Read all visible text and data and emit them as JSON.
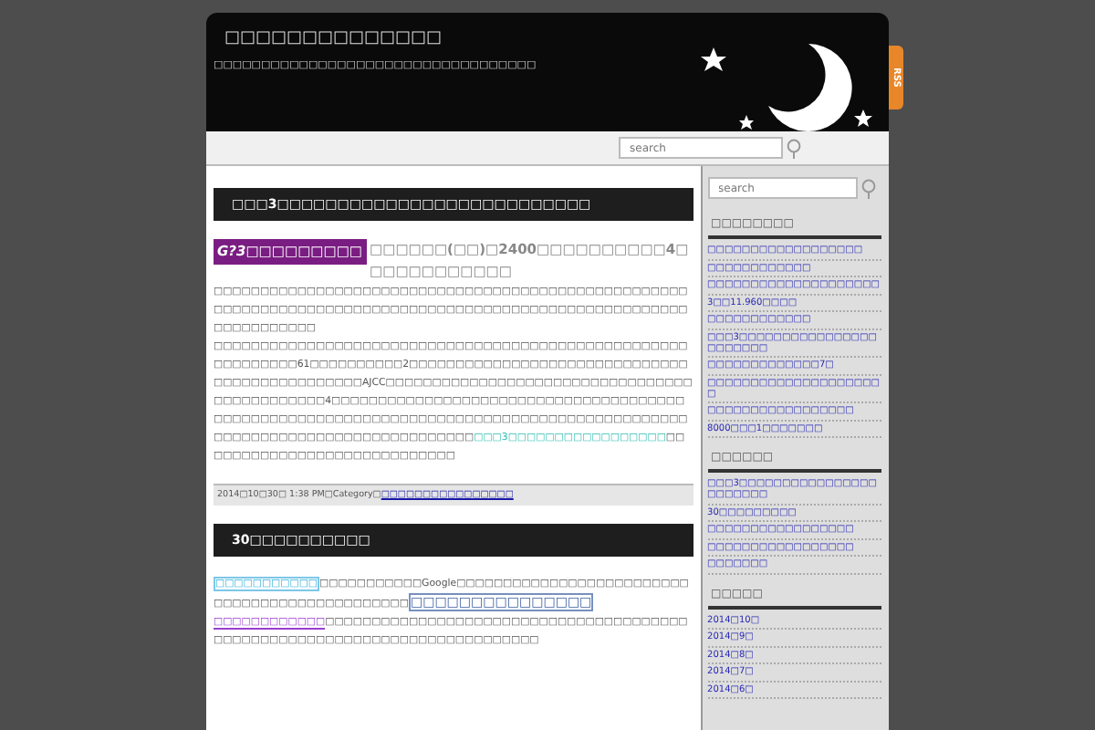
{
  "header": {
    "title": "□□□□□□□□□□□□□□",
    "subtitle": "□□□□□□□□□□□□□□□□□□□□□□□□□□□□□□□□□□",
    "rss": "RSS"
  },
  "nav": {
    "search": {
      "placeholder": "search"
    }
  },
  "posts": [
    {
      "title": "□□□3□□□□□□□□□□□□□□□□□□□□□□□□□□",
      "lead": [
        {
          "kind": "tag",
          "text": "G?3□□□□□□□□□"
        },
        {
          "kind": "heading",
          "text": "□□□□□□(□□)□2400□□□□□□□□□□4□□□□□□□□□□□□"
        }
      ],
      "paragraphs": [
        [
          {
            "kind": "text",
            "text": "□□□□□□□□□□□□□□□□□□□□□□□□□□□□□□□□□□□□□□□□□□□□□□□□□□□□□□□□□□□□□□□□□□□□□□□□□□□□□□□□□□□□□□□□□□□□□□□□□□□□□□□□□□□□□□□□□"
          }
        ],
        [
          {
            "kind": "text",
            "text": "□□□□□□□□□□□□□□□□□□□□□□□□□□□□□□□□□□□□□□□□□□□□□□□□□□□□□□□□□□□□61□□□□□□□□□□2□□□□□□□□□□□□□□□□□□□□□□□□□□□□□□□□□□□□□□□□□□□□□□AJCC□□□□□□□□□□□□□□□□□□□□□□□□□□□□□□□□□□□□□□□□□□□□□4□□□□□□□□□□□□□□□□□□□□□□□□□□□□□□□□□□□□□□□□□□□□□□□□□□□□□□□□□□□□□□□□□□□□□□□□□□□□□□□□□□□□□□□□□□□□□□□□□□□□□□□□□□□□□□□□□□□□□"
          },
          {
            "kind": "link",
            "text": "□□□3□□□□□□□□□□□□□□□□□"
          },
          {
            "kind": "text",
            "text": "□□□□□□□□□□□□□□□□□□□□□□□□□□□□"
          }
        ]
      ],
      "meta": "2014□10□30□ 1:38 PM□Category□",
      "category": "□□□□□□□□□□□□□□□□"
    },
    {
      "title": "30□□□□□□□□□□",
      "paragraphs": [
        [
          {
            "kind": "boxlink",
            "text": "□□□□□□□□□□□"
          },
          {
            "kind": "text",
            "text": "□□□□□□□□□□□Google□□□□□□□□□□□□□□□□□□□□□□□□□□□□□□□□□□□□□□□□□□□□□□"
          },
          {
            "kind": "biglink",
            "text": "□□□□□□□□□□□□□□□"
          },
          {
            "kind": "visited",
            "text": "□□□□□□□□□□□□"
          },
          {
            "kind": "text",
            "text": "□□□□□□□□□□□□□□□□□□□□□□□□□□□□□□□□□□□□□□□□□□□□□□□□□□□□□□□□□□□□□□□□□□□□□□□□□□"
          }
        ]
      ]
    }
  ],
  "sidebar": {
    "search": {
      "placeholder": "search"
    },
    "widgets": [
      {
        "title": "□□□□□□□□",
        "items": [
          "□□□□□□□□□□□□□□□□□□",
          "□□□□□□□□□□□□",
          "□□□□□□□□□□□□□□□□□□□□",
          "3□□11.960□□□□",
          "□□□□□□□□□□□□",
          "□□□3□□□□□□□□□□□□□□□□□□□□□□□",
          "□□□□□□□□□□□□□7□",
          "□□□□□□□□□□□□□□□□□□□□□",
          "□□□□□□□□□□□□□□□□□",
          "8000□□□1□□□□□□□"
        ]
      },
      {
        "title": "□□□□□□",
        "items": [
          "□□□3□□□□□□□□□□□□□□□□□□□□□□□",
          "30□□□□□□□□□",
          "□□□□□□□□□□□□□□□□□",
          "□□□□□□□□□□□□□□□□□",
          "□□□□□□□"
        ]
      },
      {
        "title": "□□□□□",
        "items": [
          "2014□10□",
          "2014□9□",
          "2014□8□",
          "2014□7□",
          "2014□6□"
        ]
      }
    ]
  }
}
